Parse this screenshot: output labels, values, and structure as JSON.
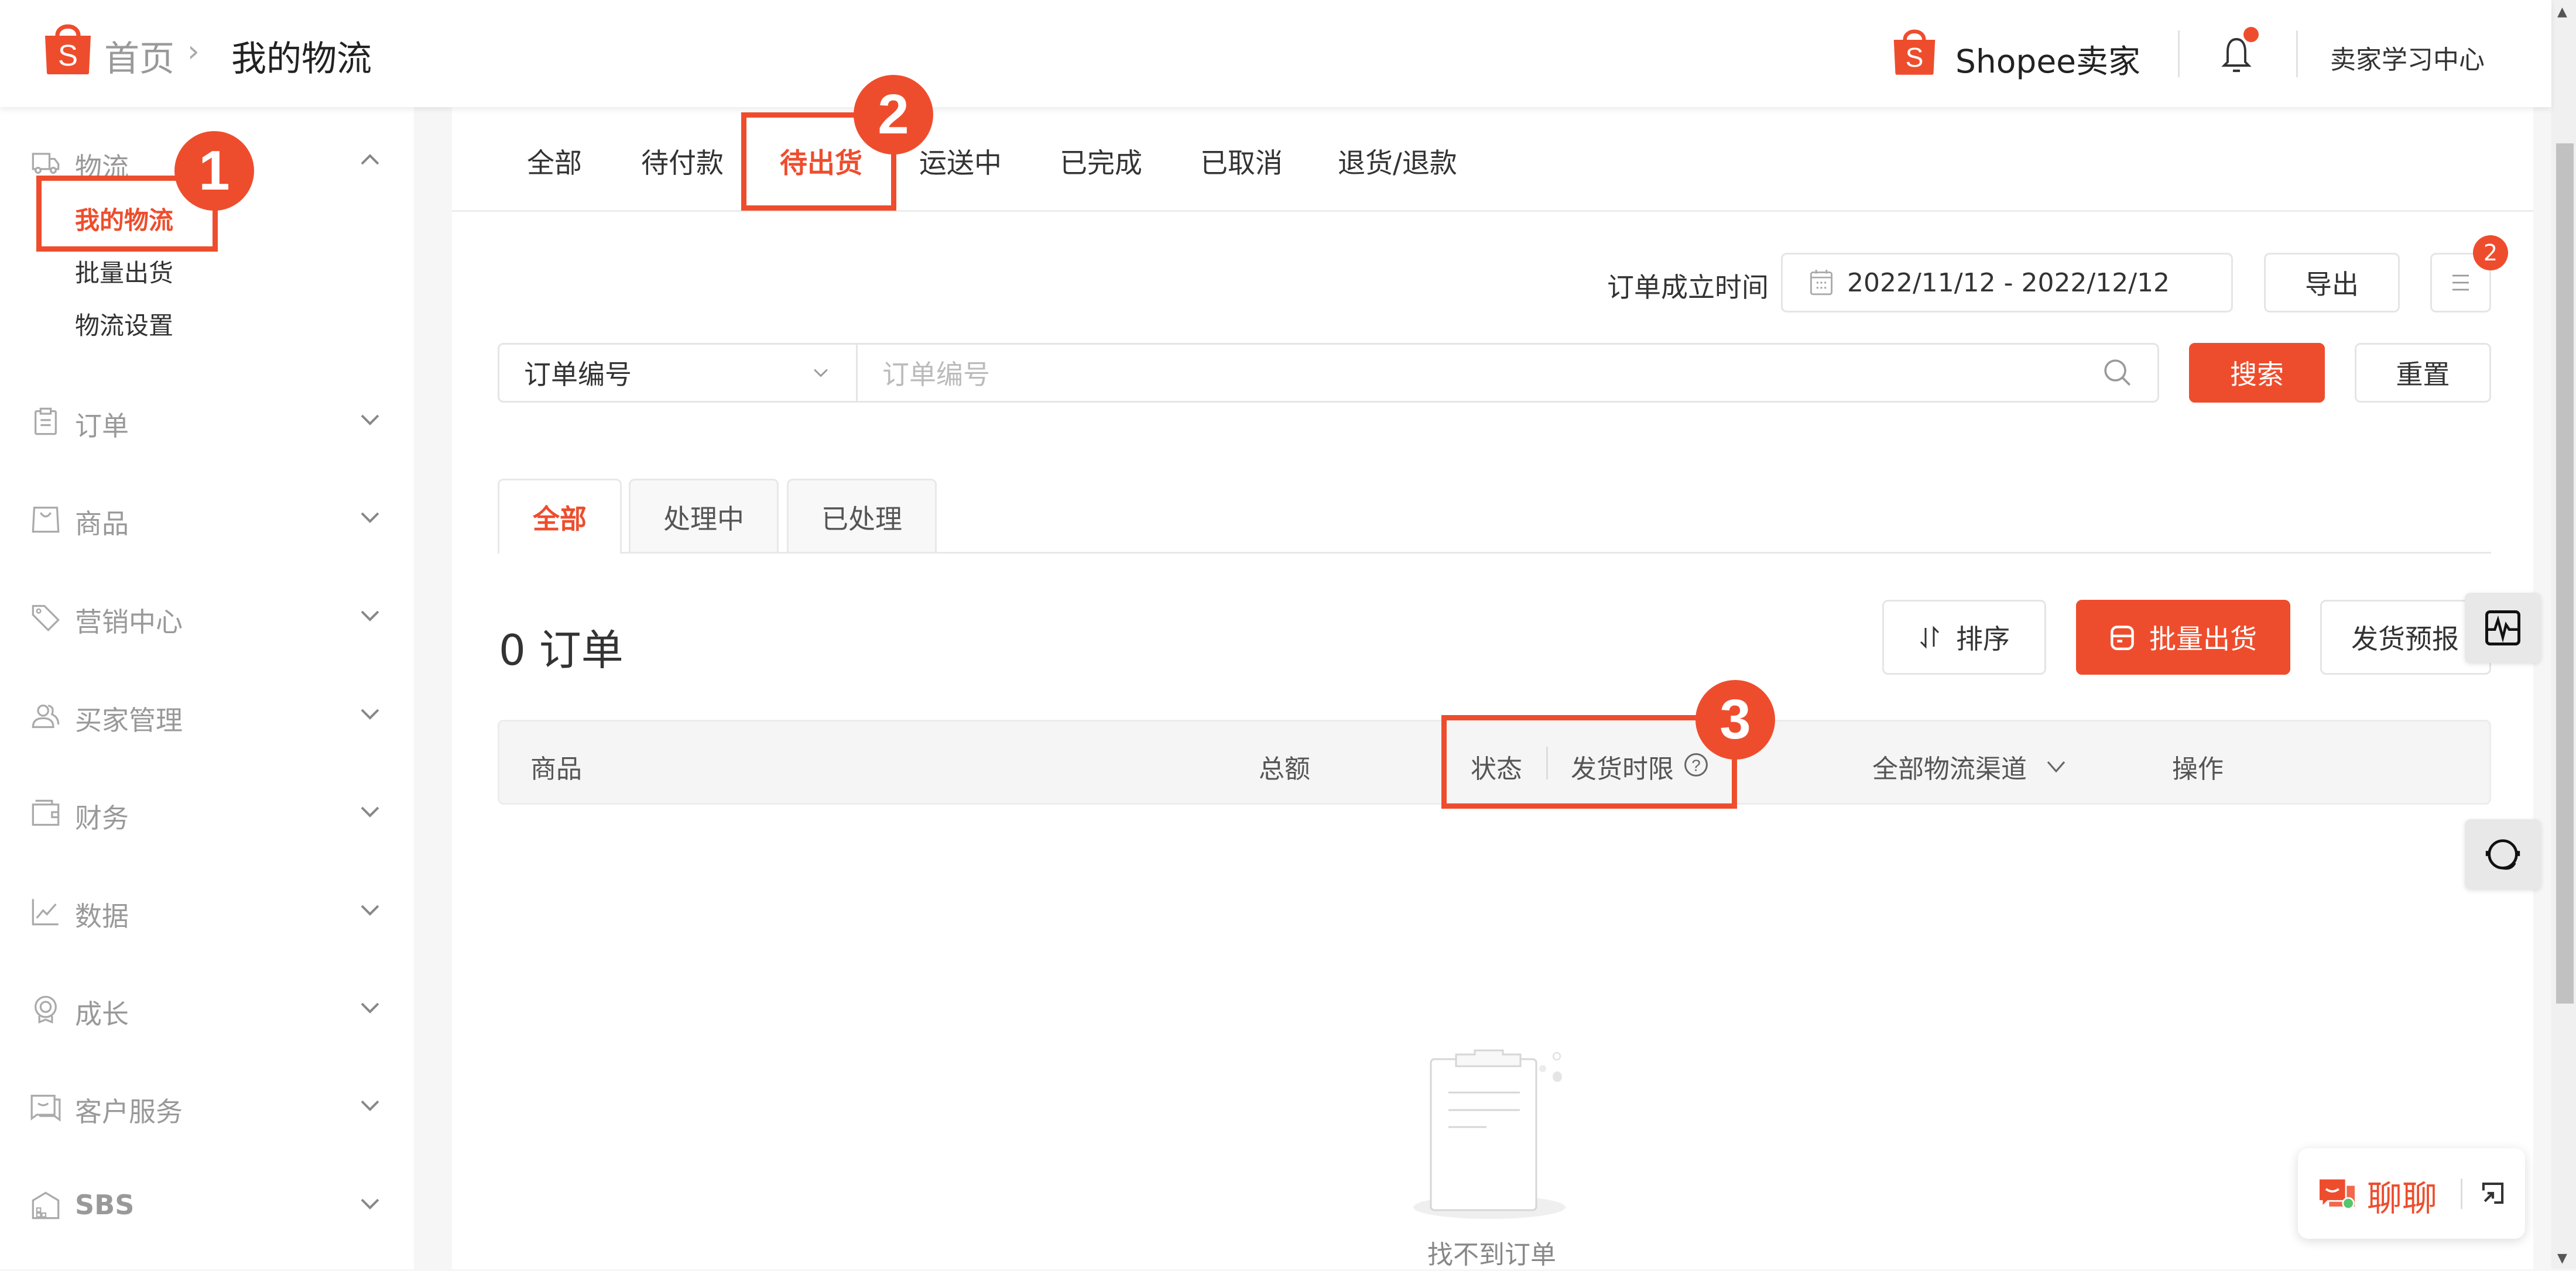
{
  "header": {
    "breadcrumb_home": "首页",
    "breadcrumb_sep": ">",
    "breadcrumb_current": "我的物流",
    "brand": "Shopee卖家",
    "learning_center": "卖家学习中心",
    "notification_dot": true
  },
  "colors": {
    "accent": "#ee4d2d",
    "online": "#52c76b"
  },
  "sidebar": {
    "logistics": {
      "label": "物流",
      "icon": "truck-icon",
      "expanded": true,
      "children": [
        {
          "label": "我的物流",
          "active": true
        },
        {
          "label": "批量出货",
          "active": false
        },
        {
          "label": "物流设置",
          "active": false
        }
      ]
    },
    "items": [
      {
        "label": "订单",
        "icon": "clipboard-icon"
      },
      {
        "label": "商品",
        "icon": "shopping-bag-icon"
      },
      {
        "label": "营销中心",
        "icon": "tag-icon"
      },
      {
        "label": "买家管理",
        "icon": "users-icon"
      },
      {
        "label": "财务",
        "icon": "wallet-icon"
      },
      {
        "label": "数据",
        "icon": "line-chart-icon"
      },
      {
        "label": "成长",
        "icon": "badge-icon"
      },
      {
        "label": "客户服务",
        "icon": "chat-bubbles-icon"
      },
      {
        "label": "SBS",
        "icon": "warehouse-icon"
      }
    ]
  },
  "status_tabs": [
    {
      "label": "全部",
      "active": false
    },
    {
      "label": "待付款",
      "active": false
    },
    {
      "label": "待出货",
      "active": true
    },
    {
      "label": "运送中",
      "active": false
    },
    {
      "label": "已完成",
      "active": false
    },
    {
      "label": "已取消",
      "active": false
    },
    {
      "label": "退货/退款",
      "active": false
    }
  ],
  "filters": {
    "date_label": "订单成立时间",
    "date_range": "2022/11/12 - 2022/12/12",
    "export_label": "导出",
    "export_list_badge": "2",
    "search_field_select": "订单编号",
    "search_placeholder": "订单编号",
    "search_button": "搜索",
    "reset_button": "重置"
  },
  "sub_tabs": [
    {
      "label": "全部",
      "active": true
    },
    {
      "label": "处理中",
      "active": false
    },
    {
      "label": "已处理",
      "active": false
    }
  ],
  "orders": {
    "count_title": "0 订单",
    "sort_button": "排序",
    "bulk_ship_button": "批量出货",
    "ship_forecast_button": "发货预报"
  },
  "table": {
    "columns": {
      "product": "商品",
      "total": "总额",
      "status": "状态",
      "ship_deadline": "发货时限",
      "channel_filter": "全部物流渠道",
      "actions": "操作"
    },
    "empty_text": "找不到订单"
  },
  "chat": {
    "label": "聊聊"
  },
  "annotations": [
    {
      "number": "1",
      "target": "我的物流"
    },
    {
      "number": "2",
      "target": "待出货"
    },
    {
      "number": "3",
      "target": "状态 | 发货时限"
    }
  ]
}
